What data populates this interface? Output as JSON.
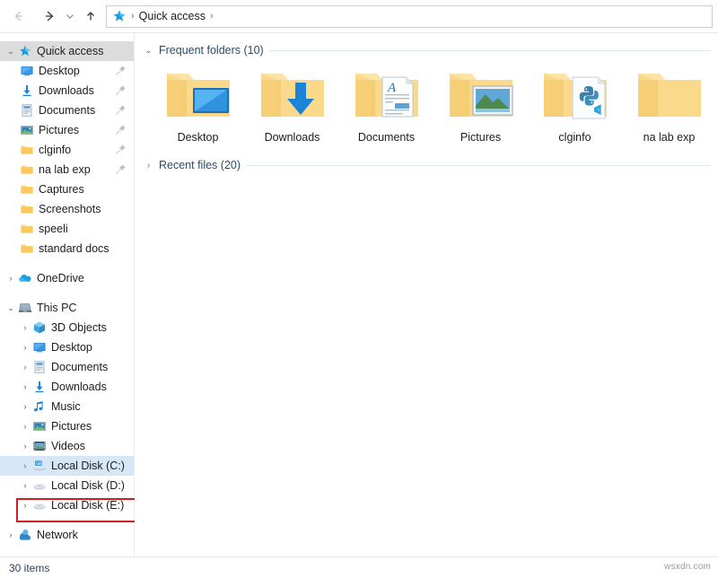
{
  "toolbar": {
    "back_label": "←",
    "forward_label": "→",
    "recent_label": "⌄",
    "up_label": "↑",
    "breadcrumb_root_icon": "quick-access-star-icon",
    "breadcrumb_sep": "›",
    "breadcrumb_text": "Quick access",
    "breadcrumb_trailing_sep": "›"
  },
  "sidebar": {
    "items": [
      {
        "label": "Quick access",
        "icon": "star-icon",
        "indent": 0,
        "chevron": "⌄",
        "selected": "grey",
        "pinned": false
      },
      {
        "label": "Desktop",
        "icon": "desktop-icon",
        "indent": 1,
        "chevron": "",
        "selected": "",
        "pinned": true
      },
      {
        "label": "Downloads",
        "icon": "download-icon",
        "indent": 1,
        "chevron": "",
        "selected": "",
        "pinned": true
      },
      {
        "label": "Documents",
        "icon": "document-icon",
        "indent": 1,
        "chevron": "",
        "selected": "",
        "pinned": true
      },
      {
        "label": "Pictures",
        "icon": "pictures-icon",
        "indent": 1,
        "chevron": "",
        "selected": "",
        "pinned": true
      },
      {
        "label": "clginfo",
        "icon": "folder-icon",
        "indent": 1,
        "chevron": "",
        "selected": "",
        "pinned": true
      },
      {
        "label": "na lab exp",
        "icon": "folder-icon",
        "indent": 1,
        "chevron": "",
        "selected": "",
        "pinned": true
      },
      {
        "label": "Captures",
        "icon": "folder-icon",
        "indent": 1,
        "chevron": "",
        "selected": "",
        "pinned": false
      },
      {
        "label": "Screenshots",
        "icon": "folder-icon",
        "indent": 1,
        "chevron": "",
        "selected": "",
        "pinned": false
      },
      {
        "label": "speeli",
        "icon": "folder-icon",
        "indent": 1,
        "chevron": "",
        "selected": "",
        "pinned": false
      },
      {
        "label": "standard docs",
        "icon": "folder-icon",
        "indent": 1,
        "chevron": "",
        "selected": "",
        "pinned": false
      },
      {
        "label": "OneDrive",
        "icon": "onedrive-icon",
        "indent": 0,
        "chevron": "›",
        "selected": "",
        "pinned": false,
        "gap_before": true
      },
      {
        "label": "This PC",
        "icon": "thispc-icon",
        "indent": 0,
        "chevron": "⌄",
        "selected": "",
        "pinned": false,
        "gap_before": true
      },
      {
        "label": "3D Objects",
        "icon": "3dobjects-icon",
        "indent": 2,
        "chevron": "›",
        "selected": "",
        "pinned": false
      },
      {
        "label": "Desktop",
        "icon": "desktop-icon",
        "indent": 2,
        "chevron": "›",
        "selected": "",
        "pinned": false
      },
      {
        "label": "Documents",
        "icon": "document-icon",
        "indent": 2,
        "chevron": "›",
        "selected": "",
        "pinned": false
      },
      {
        "label": "Downloads",
        "icon": "download-icon",
        "indent": 2,
        "chevron": "›",
        "selected": "",
        "pinned": false
      },
      {
        "label": "Music",
        "icon": "music-icon",
        "indent": 2,
        "chevron": "›",
        "selected": "",
        "pinned": false
      },
      {
        "label": "Pictures",
        "icon": "pictures-icon",
        "indent": 2,
        "chevron": "›",
        "selected": "",
        "pinned": false
      },
      {
        "label": "Videos",
        "icon": "videos-icon",
        "indent": 2,
        "chevron": "›",
        "selected": "",
        "pinned": false
      },
      {
        "label": "Local Disk (C:)",
        "icon": "os-drive-icon",
        "indent": 2,
        "chevron": "›",
        "selected": "blue",
        "pinned": false,
        "highlighted": true
      },
      {
        "label": "Local Disk (D:)",
        "icon": "drive-icon",
        "indent": 2,
        "chevron": "›",
        "selected": "",
        "pinned": false
      },
      {
        "label": "Local Disk (E:)",
        "icon": "drive-icon",
        "indent": 2,
        "chevron": "›",
        "selected": "",
        "pinned": false
      },
      {
        "label": "Network",
        "icon": "network-icon",
        "indent": 0,
        "chevron": "›",
        "selected": "",
        "pinned": false,
        "gap_before": true
      }
    ]
  },
  "main": {
    "frequent": {
      "chevron": "⌄",
      "title": "Frequent folders (10)",
      "tiles": [
        {
          "label": "Desktop",
          "overlay": "desktop-overlay"
        },
        {
          "label": "Downloads",
          "overlay": "download-overlay"
        },
        {
          "label": "Documents",
          "overlay": "document-overlay"
        },
        {
          "label": "Pictures",
          "overlay": "picture-overlay"
        },
        {
          "label": "clginfo",
          "overlay": "python-overlay"
        },
        {
          "label": "na lab exp",
          "overlay": "none"
        }
      ]
    },
    "recent": {
      "chevron": "›",
      "title": "Recent files (20)"
    }
  },
  "status": {
    "item_count": "30 items"
  },
  "watermark": {
    "text": "wsxdn.com"
  },
  "colors": {
    "folder_yellow": "#fcd88a",
    "accent_blue": "#0078d7",
    "highlight_red": "#cc1f1f",
    "selection_blue": "#d6e8f7"
  }
}
